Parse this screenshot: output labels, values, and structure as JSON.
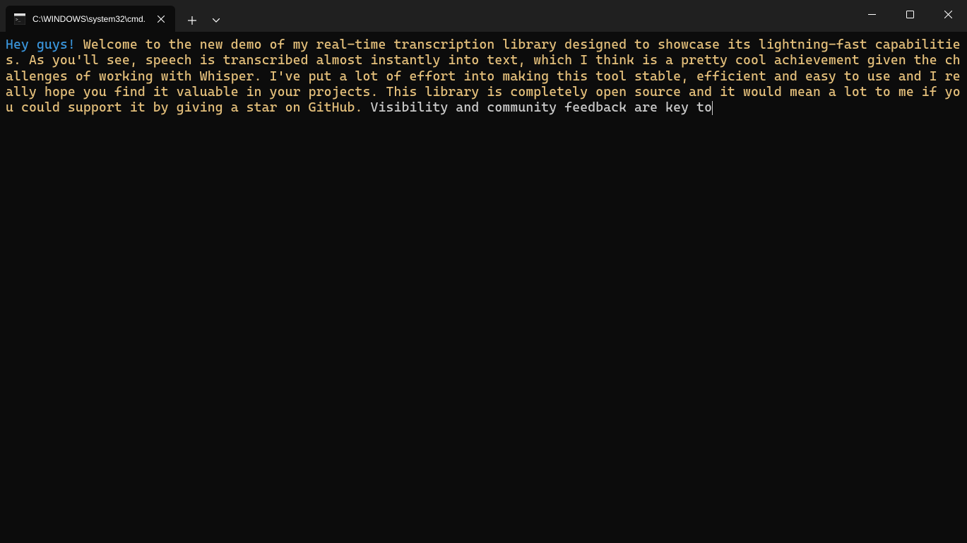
{
  "titlebar": {
    "tab_title": "C:\\WINDOWS\\system32\\cmd."
  },
  "terminal": {
    "segment_cyan": "Hey guys! ",
    "segment_yellow": "Welcome to the new demo of my real-time transcription library designed to showcase its lightning-fast capabilities. As you'll see, speech is transcribed almost instantly into text, which I think is a pretty cool achievement given the challenges of working with Whisper. I've put a lot of effort into making this tool stable, efficient and easy to use and I really hope you find it valuable in your projects. This library is completely open source and it would mean a lot to me if you could support it by giving a star on GitHub. ",
    "segment_white": "Visibility and community feedback are key to"
  },
  "colors": {
    "cyan": "#3a96dd",
    "yellow": "#e5c07b",
    "white": "#cccccc",
    "background": "#0c0c0c",
    "titlebar": "#202020"
  }
}
